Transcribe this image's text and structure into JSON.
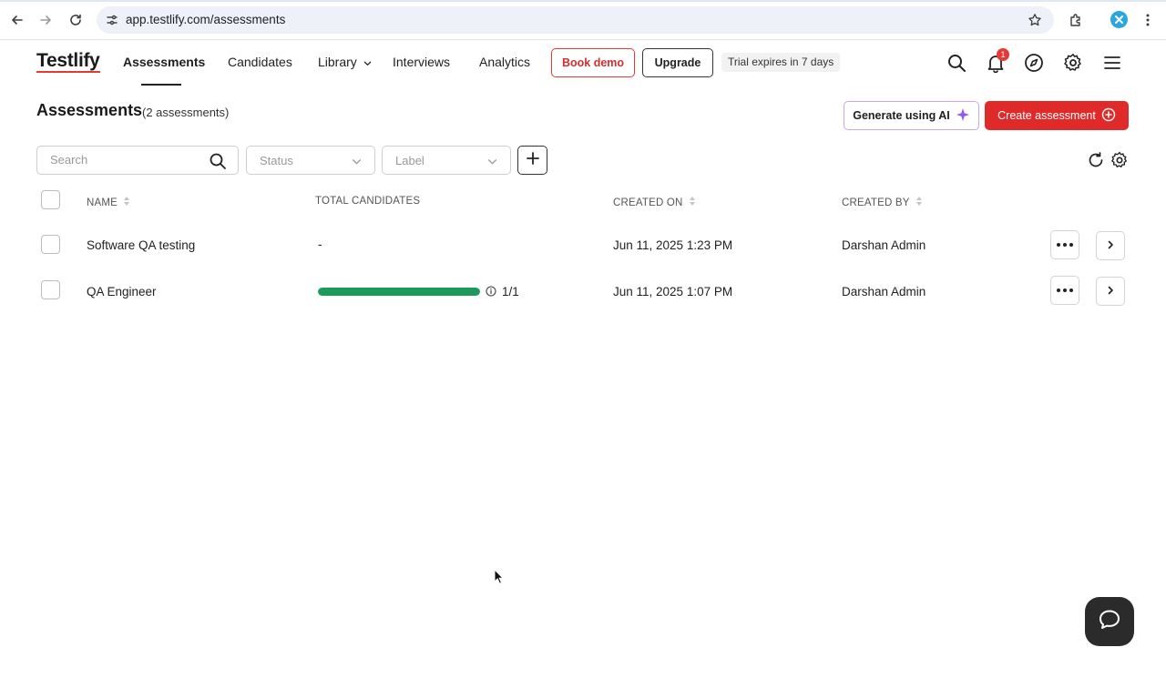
{
  "browser": {
    "url": "app.testlify.com/assessments"
  },
  "header": {
    "logo": "Testlify",
    "nav": [
      {
        "label": "Assessments",
        "active": true
      },
      {
        "label": "Candidates"
      },
      {
        "label": "Library",
        "has_dropdown": true
      },
      {
        "label": "Interviews"
      },
      {
        "label": "Analytics"
      }
    ],
    "book_demo": "Book demo",
    "upgrade": "Upgrade",
    "trial": "Trial expires in 7 days",
    "notification_count": "1"
  },
  "page": {
    "title": "Assessments",
    "count": "(2 assessments)",
    "generate_ai": "Generate using AI",
    "create": "Create assessment"
  },
  "filters": {
    "search_placeholder": "Search",
    "status_placeholder": "Status",
    "label_placeholder": "Label"
  },
  "table": {
    "columns": {
      "name": "NAME",
      "total_candidates": "TOTAL CANDIDATES",
      "created_on": "CREATED ON",
      "created_by": "CREATED BY"
    },
    "rows": [
      {
        "name": "Software QA testing",
        "candidates": "-",
        "progress": null,
        "created_on": "Jun 11, 2025 1:23 PM",
        "created_by": "Darshan Admin"
      },
      {
        "name": "QA Engineer",
        "candidates": "1/1",
        "progress": 1.0,
        "created_on": "Jun 11, 2025 1:07 PM",
        "created_by": "Darshan Admin"
      }
    ]
  },
  "colors": {
    "brand_red": "#e02a2a",
    "progress_green": "#1c9a5b",
    "ai_border": "#c9a8f0",
    "ai_sparkle": "#8e5cf0"
  },
  "icons": [
    "back-icon",
    "forward-icon",
    "reload-icon",
    "site-settings-icon",
    "star-icon",
    "extensions-icon",
    "profile-icon",
    "more-vert-icon",
    "search-icon",
    "bell-icon",
    "compass-icon",
    "gear-icon",
    "menu-icon",
    "sparkle-icon",
    "plus-circle-icon",
    "chevron-down-icon",
    "plus-icon",
    "refresh-icon",
    "sort-icon",
    "info-icon",
    "chevron-right-icon",
    "chat-icon"
  ]
}
